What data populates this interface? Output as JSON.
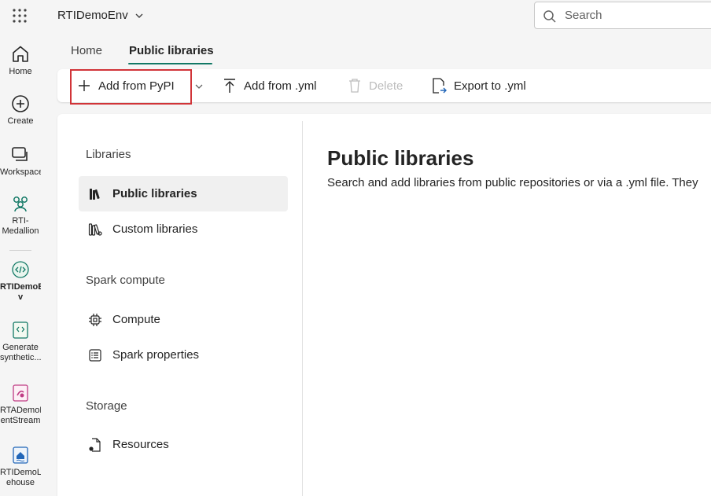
{
  "header": {
    "workspace_name": "RTIDemoEnv",
    "search_placeholder": "Search"
  },
  "rail": {
    "items": [
      {
        "label": "Home",
        "icon": "home-icon"
      },
      {
        "label": "Create",
        "icon": "create-icon"
      },
      {
        "label": "Workspaces",
        "icon": "workspaces-icon"
      },
      {
        "label_line1": "RTI-",
        "label_line2": "Medallion",
        "icon": "medallion-icon"
      },
      {
        "label_line1": "RTIDemoEn",
        "label_line2": "v",
        "icon": "environment-icon"
      },
      {
        "label_line1": "Generate",
        "label_line2": "synthetic...",
        "icon": "notebook-icon"
      },
      {
        "label_line1": "RTADemoEv",
        "label_line2": "entStream",
        "icon": "eventstream-icon"
      },
      {
        "label_line1": "RTIDemoLak",
        "label_line2": "ehouse",
        "icon": "lakehouse-icon"
      }
    ]
  },
  "tabs": [
    {
      "label": "Home"
    },
    {
      "label": "Public libraries"
    }
  ],
  "toolbar": {
    "add_pypi": "Add from PyPI",
    "add_yml": "Add from .yml",
    "delete": "Delete",
    "export_yml": "Export to .yml"
  },
  "sidebar": {
    "sections": [
      {
        "title": "Libraries",
        "items": [
          {
            "label": "Public libraries",
            "selected": true
          },
          {
            "label": "Custom libraries"
          }
        ]
      },
      {
        "title": "Spark compute",
        "items": [
          {
            "label": "Compute"
          },
          {
            "label": "Spark properties"
          }
        ]
      },
      {
        "title": "Storage",
        "items": [
          {
            "label": "Resources"
          }
        ]
      }
    ]
  },
  "main": {
    "title": "Public libraries",
    "description": "Search and add libraries from public repositories or via a .yml file. They"
  },
  "colors": {
    "accent": "#117865",
    "highlight_border": "#d13438"
  }
}
